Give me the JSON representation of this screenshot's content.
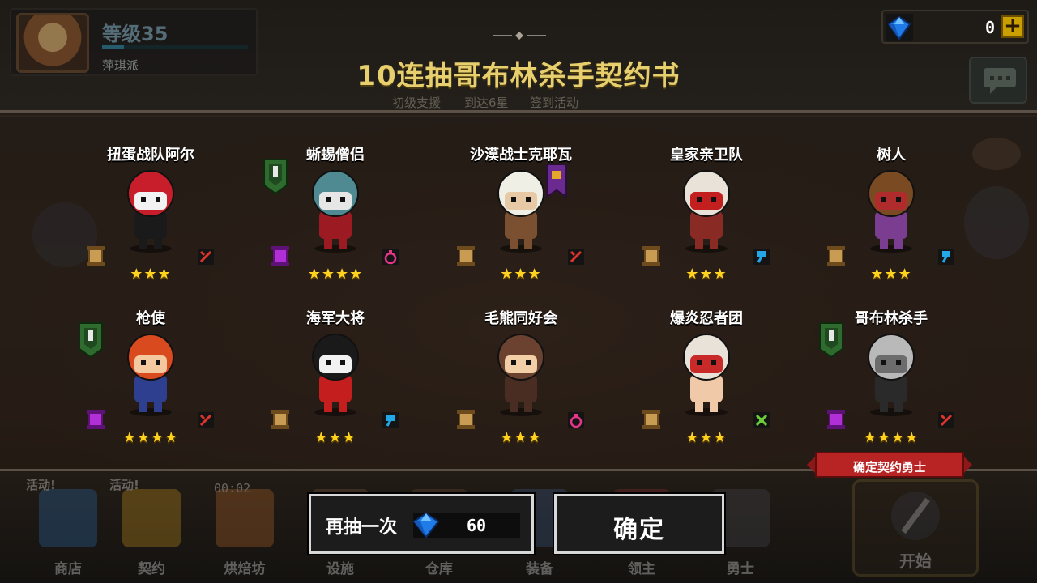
{
  "player": {
    "level_label": "等级35",
    "level_progress": 0.15,
    "nickname": "萍琪派"
  },
  "currency": {
    "gems": "0",
    "add_label": "+"
  },
  "header": {
    "title": "10连抽哥布林杀手契约书"
  },
  "background_labels": [
    "初级支援",
    "到达6星",
    "签到活动"
  ],
  "results": [
    {
      "name": "扭蛋战队阿尔",
      "stars": "★★★",
      "rank": "bronze",
      "attribute": "slash",
      "attribute_color": "#e0342b",
      "crest": false,
      "palette": [
        "#c81d2b",
        "#f2f2f2",
        "#1a1a1a"
      ]
    },
    {
      "name": "蜥蜴僧侣",
      "stars": "★★★★",
      "rank": "purple",
      "attribute": "magic",
      "attribute_color": "#e7368a",
      "crest": true,
      "palette": [
        "#4f8a93",
        "#e6e6e6",
        "#9c1a22"
      ]
    },
    {
      "name": "沙漠战士克耶瓦",
      "stars": "★★★",
      "rank": "bronze",
      "attribute": "slash",
      "attribute_color": "#e0342b",
      "crest": false,
      "banner": true,
      "palette": [
        "#efefe6",
        "#e7c9a5",
        "#7a5030"
      ]
    },
    {
      "name": "皇家亲卫队",
      "stars": "★★★",
      "rank": "bronze",
      "attribute": "blunt",
      "attribute_color": "#23a7e8",
      "crest": false,
      "palette": [
        "#e8e2d8",
        "#c41f1f",
        "#8a2a24"
      ]
    },
    {
      "name": "树人",
      "stars": "★★★",
      "rank": "bronze",
      "attribute": "blunt",
      "attribute_color": "#23a7e8",
      "crest": false,
      "palette": [
        "#7a4a22",
        "#b02b2b",
        "#7a3d90"
      ]
    },
    {
      "name": "枪使",
      "stars": "★★★★",
      "rank": "purple",
      "attribute": "slash",
      "attribute_color": "#e0342b",
      "crest": true,
      "palette": [
        "#d94a1e",
        "#f4c9a0",
        "#2e3f8f"
      ]
    },
    {
      "name": "海军大将",
      "stars": "★★★",
      "rank": "bronze",
      "attribute": "blunt",
      "attribute_color": "#23a7e8",
      "crest": false,
      "palette": [
        "#1a1a1a",
        "#f2f2f2",
        "#c41e1e"
      ]
    },
    {
      "name": "毛熊同好会",
      "stars": "★★★",
      "rank": "bronze",
      "attribute": "magic",
      "attribute_color": "#e7368a",
      "crest": false,
      "palette": [
        "#6b4230",
        "#f3cfa7",
        "#4a2d22"
      ]
    },
    {
      "name": "爆炎忍者团",
      "stars": "★★★",
      "rank": "bronze",
      "attribute": "pierce",
      "attribute_color": "#6ccf3a",
      "crest": false,
      "palette": [
        "#e8e2d8",
        "#c82a2a",
        "#f0c9a8"
      ]
    },
    {
      "name": "哥布林杀手",
      "stars": "★★★★",
      "rank": "purple",
      "attribute": "slash",
      "attribute_color": "#e0342b",
      "crest": true,
      "palette": [
        "#b9b9b9",
        "#6c6c6c",
        "#2a2a2a"
      ]
    }
  ],
  "ribbon": {
    "label": "确定契约勇士"
  },
  "actions": {
    "retry_label": "再抽一次",
    "retry_cost": "60",
    "confirm_label": "确定"
  },
  "nav": [
    {
      "label": "商店",
      "tag": "活动!"
    },
    {
      "label": "契约",
      "tag": "活动!"
    },
    {
      "label": "烘焙坊",
      "timer": "00:02"
    },
    {
      "label": "设施"
    },
    {
      "label": "仓库"
    },
    {
      "label": "装备"
    },
    {
      "label": "领主"
    },
    {
      "label": "勇士"
    }
  ],
  "start": {
    "label": "开始"
  },
  "colors": {
    "title_gold": "#e8cf6e",
    "star_yellow": "#ffd21f",
    "ribbon_red": "#b82424",
    "gem_blue": "#1f7be8"
  }
}
